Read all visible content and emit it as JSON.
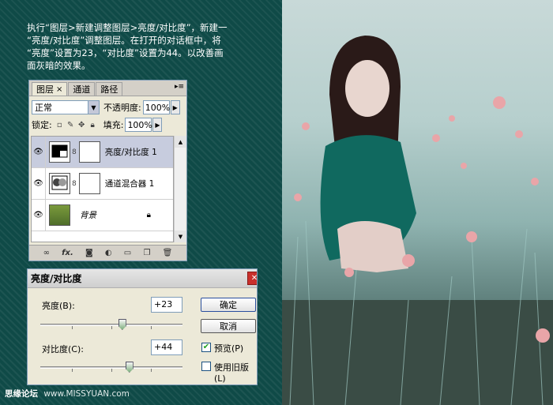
{
  "instructions": {
    "line1": "执行“图层>新建调整图层>亮度/对比度”，新建一",
    "line2": "“亮度/对比度”调整图层。在打开的对话框中，将",
    "line3": "“亮度”设置为23，“对比度”设置为44。以改善画",
    "line4": "面灰暗的效果。"
  },
  "layers_panel": {
    "tabs": [
      {
        "label": "图层",
        "close": "×"
      },
      {
        "label": "通道"
      },
      {
        "label": "路径"
      }
    ],
    "menu_glyph": "▸≡",
    "blend_mode": "正常",
    "opacity_label": "不透明度:",
    "opacity_value": "100%",
    "lock_label": "锁定:",
    "fill_label": "填充:",
    "fill_value": "100%",
    "layers": [
      {
        "name": "亮度/对比度 1",
        "selected": true
      },
      {
        "name": "通道混合器 1",
        "selected": false
      },
      {
        "name": "背景",
        "selected": false,
        "locked": true
      }
    ],
    "footer_icons": [
      "link-icon",
      "fx-icon",
      "mask-icon",
      "adjustment-icon",
      "folder-icon",
      "new-layer-icon",
      "trash-icon"
    ],
    "footer_fx": "fx."
  },
  "bc_dialog": {
    "title": "亮度/对比度",
    "brightness_label": "亮度(B):",
    "brightness_value": "+23",
    "brightness_level": 23,
    "contrast_label": "对比度(C):",
    "contrast_value": "+44",
    "contrast_level": 44,
    "ok_label": "确定",
    "cancel_label": "取消",
    "preview_label": "预览(P)",
    "preview_checked": true,
    "legacy_label": "使用旧版(L)",
    "legacy_checked": false
  },
  "watermark": {
    "left": "思缘论坛",
    "right": "www.MISSYUAN.com"
  }
}
